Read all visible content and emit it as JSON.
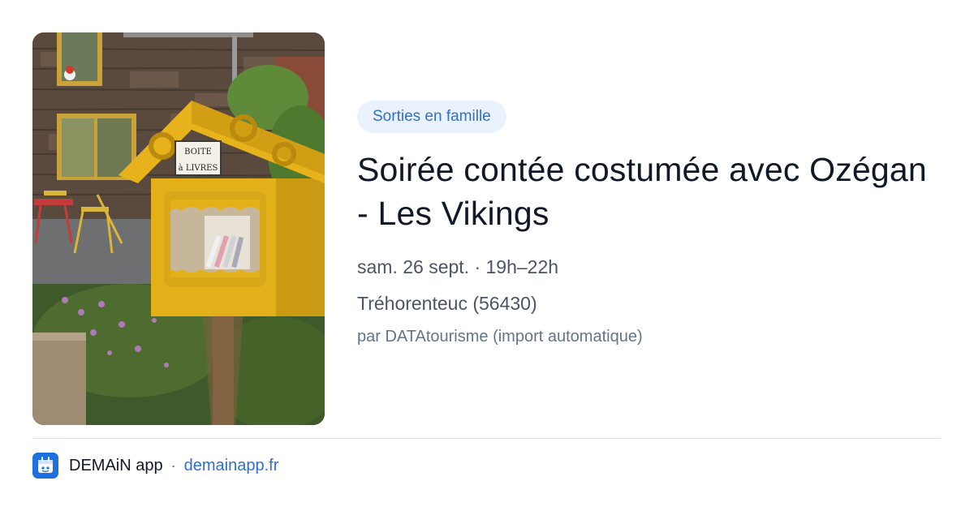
{
  "event": {
    "category": "Sorties en famille",
    "title": "Soirée contée costumée avec Ozégan - Les Vikings",
    "date": "sam. 26 sept. · 19h–22h",
    "location": "Tréhorenteuc (56430)",
    "source": "par DATAtourisme (import automatique)"
  },
  "photo": {
    "sign_line1": "BOITE",
    "sign_line2": "à LIVRES"
  },
  "footer": {
    "app_name": "DEMAiN app",
    "separator": "·",
    "domain": "demainapp.fr"
  },
  "colors": {
    "accent": "#2f6fd1",
    "tag_bg": "#eaf2fd",
    "logo_bg": "#1f6fe0"
  },
  "icons": {
    "app_logo": "demain-app-icon"
  }
}
